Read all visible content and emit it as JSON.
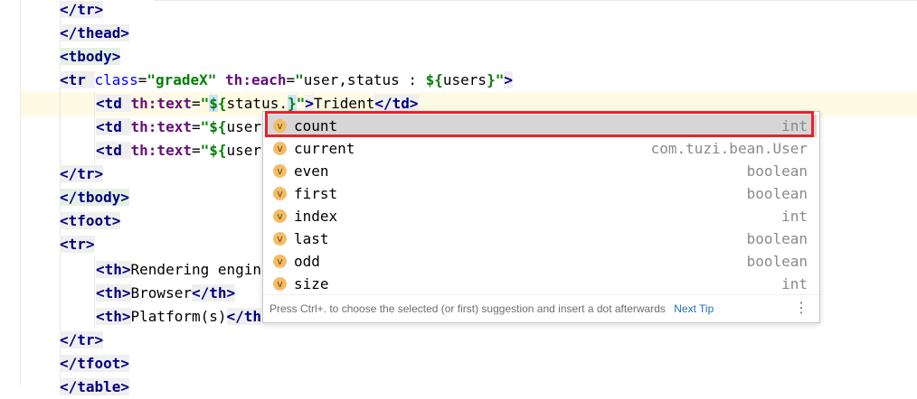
{
  "code_lines": [
    {
      "text": "</tr>"
    },
    {
      "text": "</thead>"
    },
    {
      "text": "<tbody>"
    },
    {
      "text": "<tr class=\"gradeX\" th:each=\"user,status : ${users}\">"
    },
    {
      "text": "<td th:text=\"${status.}\">Trident</td>"
    },
    {
      "text": "<td th:text=\"${user"
    },
    {
      "text": "<td th:text=\"${user"
    },
    {
      "text": "</tr>"
    },
    {
      "text": "</tbody>"
    },
    {
      "text": "<tfoot>"
    },
    {
      "text": "<tr>"
    },
    {
      "text": "<th>Rendering engin"
    },
    {
      "text": "<th>Browser</th>"
    },
    {
      "text": "<th>Platform(s)</th"
    },
    {
      "text": "</tr>"
    },
    {
      "text": "</tfoot>"
    }
  ],
  "completion": {
    "items": [
      {
        "icon": "v",
        "name": "count",
        "type": "int"
      },
      {
        "icon": "v",
        "name": "current",
        "type": "com.tuzi.bean.User"
      },
      {
        "icon": "v",
        "name": "even",
        "type": "boolean"
      },
      {
        "icon": "v",
        "name": "first",
        "type": "boolean"
      },
      {
        "icon": "v",
        "name": "index",
        "type": "int"
      },
      {
        "icon": "v",
        "name": "last",
        "type": "boolean"
      },
      {
        "icon": "v",
        "name": "odd",
        "type": "boolean"
      },
      {
        "icon": "v",
        "name": "size",
        "type": "int"
      }
    ],
    "footer_hint": "Press Ctrl+. to choose the selected (or first) suggestion and insert a dot afterwards",
    "next_tip": "Next Tip",
    "menu_glyph": "⋮"
  },
  "colors": {
    "selection_outline": "#e8212b",
    "current_line": "#fffae3",
    "variable_icon": "#f2bc68"
  }
}
